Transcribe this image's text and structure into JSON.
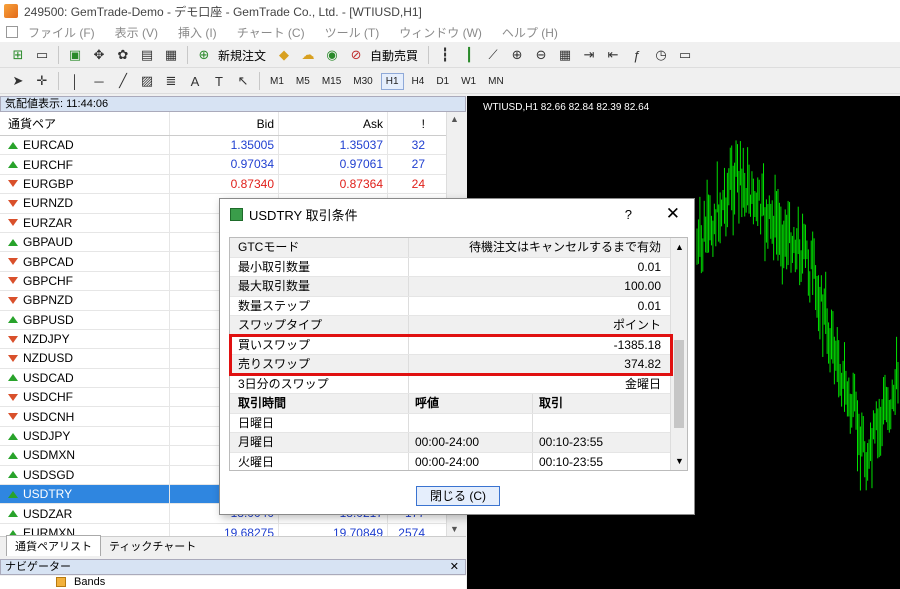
{
  "window": {
    "title": "249500: GemTrade-Demo - デモ口座 - GemTrade Co., Ltd. - [WTIUSD,H1]"
  },
  "menu": [
    "ファイル (F)",
    "表示 (V)",
    "挿入 (I)",
    "チャート (C)",
    "ツール (T)",
    "ウィンドウ (W)",
    "ヘルプ (H)"
  ],
  "toolbar": {
    "new_order": "新規注文",
    "auto_trade": "自動売買",
    "timeframes": [
      "M1",
      "M5",
      "M15",
      "M30",
      "H1",
      "H4",
      "D1",
      "W1",
      "MN"
    ],
    "active_timeframe": "H1"
  },
  "market_watch": {
    "header": "気配値表示: 11:44:06",
    "columns": {
      "symbol": "通貨ペア",
      "bid": "Bid",
      "ask": "Ask",
      "spread": "!"
    },
    "rows": [
      {
        "symbol": "EURCAD",
        "dir": "up",
        "bid": "1.35005",
        "ask": "1.35037",
        "spread": "32",
        "color": "blue"
      },
      {
        "symbol": "EURCHF",
        "dir": "up",
        "bid": "0.97034",
        "ask": "0.97061",
        "spread": "27",
        "color": "blue"
      },
      {
        "symbol": "EURGBP",
        "dir": "down",
        "bid": "0.87340",
        "ask": "0.87364",
        "spread": "24",
        "color": "red"
      },
      {
        "symbol": "EURNZD",
        "dir": "down",
        "bid": "",
        "ask": "",
        "spread": "",
        "color": "blue"
      },
      {
        "symbol": "EURZAR",
        "dir": "down",
        "bid": "",
        "ask": "",
        "spread": "",
        "color": "blue"
      },
      {
        "symbol": "GBPAUD",
        "dir": "up",
        "bid": "",
        "ask": "",
        "spread": "",
        "color": "blue"
      },
      {
        "symbol": "GBPCAD",
        "dir": "down",
        "bid": "",
        "ask": "",
        "spread": "",
        "color": "blue"
      },
      {
        "symbol": "GBPCHF",
        "dir": "down",
        "bid": "",
        "ask": "",
        "spread": "",
        "color": "blue"
      },
      {
        "symbol": "GBPNZD",
        "dir": "down",
        "bid": "",
        "ask": "",
        "spread": "",
        "color": "blue"
      },
      {
        "symbol": "GBPUSD",
        "dir": "up",
        "bid": "",
        "ask": "",
        "spread": "",
        "color": "blue"
      },
      {
        "symbol": "NZDJPY",
        "dir": "down",
        "bid": "",
        "ask": "",
        "spread": "",
        "color": "blue"
      },
      {
        "symbol": "NZDUSD",
        "dir": "down",
        "bid": "",
        "ask": "",
        "spread": "",
        "color": "blue"
      },
      {
        "symbol": "USDCAD",
        "dir": "up",
        "bid": "",
        "ask": "",
        "spread": "",
        "color": "blue"
      },
      {
        "symbol": "USDCHF",
        "dir": "down",
        "bid": "",
        "ask": "",
        "spread": "",
        "color": "blue"
      },
      {
        "symbol": "USDCNH",
        "dir": "down",
        "bid": "",
        "ask": "",
        "spread": "",
        "color": "blue"
      },
      {
        "symbol": "USDJPY",
        "dir": "up",
        "bid": "",
        "ask": "",
        "spread": "",
        "color": "blue"
      },
      {
        "symbol": "USDMXN",
        "dir": "up",
        "bid": "",
        "ask": "",
        "spread": "",
        "color": "blue"
      },
      {
        "symbol": "USDSGD",
        "dir": "up",
        "bid": "",
        "ask": "",
        "spread": "",
        "color": "blue"
      },
      {
        "symbol": "USDTRY",
        "dir": "up",
        "bid": "",
        "ask": "",
        "spread": "",
        "color": "blue",
        "selected": true
      },
      {
        "symbol": "USDZAR",
        "dir": "up",
        "bid": "18.0040",
        "ask": "18.0217",
        "spread": "177",
        "color": "blue"
      },
      {
        "symbol": "EURMXN",
        "dir": "up",
        "bid": "19.68275",
        "ask": "19.70849",
        "spread": "2574",
        "color": "blue"
      }
    ],
    "tabs": [
      "通貨ペアリスト",
      "ティックチャート"
    ]
  },
  "navigator": {
    "header": "ナビゲーター",
    "item": "Bands"
  },
  "chart": {
    "label": "WTIUSD,H1  82.66 82.84 82.39 82.64",
    "candle_color": "#00e000"
  },
  "dialog": {
    "title": "USDTRY 取引条件",
    "help": "?",
    "close": "✕",
    "rows": [
      {
        "key": "GTCモード",
        "value": "待機注文はキャンセルするまで有効",
        "gray": true
      },
      {
        "key": "最小取引数量",
        "value": "0.01"
      },
      {
        "key": "最大取引数量",
        "value": "100.00",
        "gray": true
      },
      {
        "key": "数量ステップ",
        "value": "0.01"
      },
      {
        "key": "スワップタイプ",
        "value": "ポイント",
        "gray": true
      },
      {
        "key": "買いスワップ",
        "value": "-1385.18"
      },
      {
        "key": "売りスワップ",
        "value": "374.82",
        "gray": true
      },
      {
        "key": "3日分のスワップ",
        "value": "金曜日"
      }
    ],
    "session_header": [
      "取引時間",
      "呼値",
      "取引"
    ],
    "sessions": [
      {
        "day": "日曜日",
        "quote": "",
        "trade": ""
      },
      {
        "day": "月曜日",
        "quote": "00:00-24:00",
        "trade": "00:10-23:55",
        "gray": true
      },
      {
        "day": "火曜日",
        "quote": "00:00-24:00",
        "trade": "00:10-23:55"
      }
    ],
    "button": "閉じる (C)",
    "highlight_color": "#e01010"
  }
}
